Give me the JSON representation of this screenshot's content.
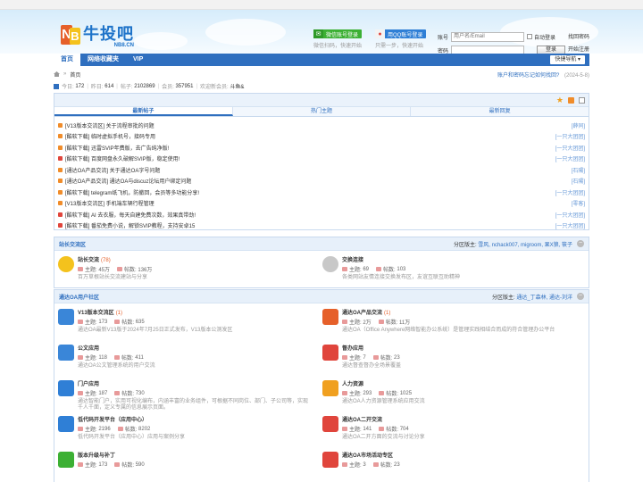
{
  "header": {
    "logo_title": "牛投吧",
    "logo_sub": "NB8.CN",
    "wechat_label": "微信账号登录",
    "wechat_sub": "微信扫码，快速开始",
    "qq_label": "用QQ账号登录",
    "qq_sub": "只需一步，快速开始",
    "account_label": "账号",
    "account_placeholder": "用户名/Email",
    "auto_login": "自动登录",
    "find_password": "找回密码",
    "password_label": "密码",
    "login_button": "登录",
    "register": "开始注册"
  },
  "nav": {
    "items": [
      {
        "label": "首页"
      },
      {
        "label": "网络收藏夹"
      },
      {
        "label": "VIP"
      }
    ],
    "quick": "快捷导航 ▾"
  },
  "breadcrumb": {
    "home": "首页",
    "right_link": "账户和密码忘记如何找回?",
    "right_date": "(2024-5-8)"
  },
  "stats": {
    "today_label": "今日:",
    "today": "172",
    "yesterday_label": "昨日:",
    "yesterday": "614",
    "posts_label": "帖子:",
    "posts": "2102869",
    "members_label": "会员:",
    "members": "357951",
    "welcome_label": "欢迎新会员:",
    "welcome": "斗鱼&"
  },
  "tabs": [
    "最新帖子",
    "热门主题",
    "最新回复"
  ],
  "threads": [
    {
      "title": "[V13版本交流区] 关于流程审批的问题",
      "author": "[薛同]",
      "color": "#f08c2a"
    },
    {
      "title": "[酷软下载] 临时虚拟手机号，接码专用",
      "author": "[一只大团团]",
      "color": "#f08c2a"
    },
    {
      "title": "[酷软下载] 迅雷SVIP年费版，去广告纯净版!",
      "author": "[一只大团团]",
      "color": "#f08c2a"
    },
    {
      "title": "[酷软下载] 百度网盘永久破解SVIP版，稳定使用!",
      "author": "[一只大团团]",
      "color": "#e0453c"
    },
    {
      "title": "[通达OA产品交流] 关于通达OA字号问题",
      "author": "[石陽]",
      "color": "#f08c2a"
    },
    {
      "title": "[通达OA产品交流] 通达OA与discuz论坛用户绑定问题",
      "author": "[石陽]",
      "color": "#f08c2a"
    },
    {
      "title": "[酷软下载] telegram纸飞机，防撤回，会员等多功能分享!",
      "author": "[一只大团团]",
      "color": "#f08c2a"
    },
    {
      "title": "[V13版本交流区] 手机端车辆行程管理",
      "author": "[零客]",
      "color": "#f08c2a"
    },
    {
      "title": "[酷软下载] AI 去衣服，每天自建免费次数，效果真带劲!",
      "author": "[一只大团团]",
      "color": "#e0453c"
    },
    {
      "title": "[酷软下载] 番茄免费小说，解锁SVIP教程，支持安卓15",
      "author": "[一只大团团]",
      "color": "#e0453c"
    }
  ],
  "section1": {
    "name": "站长交流区",
    "mods_label": "分区版主:",
    "mods": "雪风, nchack007, migroom, 果X狼, 筱子",
    "forums": [
      {
        "title": "站长交流",
        "new": "(78)",
        "topic_label": "主题:",
        "topics": "45万",
        "post_label": "帖数:",
        "posts": "136万",
        "desc": "百万草根站长交流建站与分享"
      },
      {
        "title": "交换连接",
        "new": "",
        "topic_label": "主题:",
        "topics": "69",
        "post_label": "帖数:",
        "posts": "103",
        "desc": "各类网站友情连接交换发布区，友谊互联互助精神"
      }
    ]
  },
  "section2": {
    "name": "通达OA用户社区",
    "mods_label": "分区版主:",
    "mods": "通达_丁森林, 通达-刘洋",
    "forums": [
      {
        "title": "V13版本交流区",
        "new": "(1)",
        "topic_label": "主题:",
        "topics": "173",
        "post_label": "帖数:",
        "posts": "635",
        "desc": "通达OA最新V13版于2024年7月25日正式发布，V13版本公测发区"
      },
      {
        "title": "通达OA产品交流",
        "new": "(1)",
        "topic_label": "主题:",
        "topics": "2万",
        "post_label": "帖数:",
        "posts": "11万",
        "desc": "通达OA（Office Anywhere网络智能办公系统）是管理实践相结合而成的符合管理办公平台"
      },
      {
        "title": "公文应用",
        "new": "",
        "topic_label": "主题:",
        "topics": "118",
        "post_label": "帖数:",
        "posts": "411",
        "desc": "通达OA公文管理系统的用户交流"
      },
      {
        "title": "督办应用",
        "new": "",
        "topic_label": "主题:",
        "topics": "7",
        "post_label": "帖数:",
        "posts": "23",
        "desc": "通达督查督办全场景覆盖"
      },
      {
        "title": "门户应用",
        "new": "",
        "topic_label": "主题:",
        "topics": "187",
        "post_label": "帖数:",
        "posts": "730",
        "desc": "通达智能门户，实用可视化编布，内涵丰富的业务组件，可根据不同岗位、部门、子公司等，实现千人千面，定义专属的信息展示页面。"
      },
      {
        "title": "人力资源",
        "new": "",
        "topic_label": "主题:",
        "topics": "293",
        "post_label": "帖数:",
        "posts": "1025",
        "desc": "通达OA人力资源管理系统应用交流"
      },
      {
        "title": "低代码开发平台（应用中心）",
        "new": "",
        "topic_label": "主题:",
        "topics": "2196",
        "post_label": "帖数:",
        "posts": "8202",
        "desc": "低代码开发平台（应用中心）应用与案例分享"
      },
      {
        "title": "通达OA二开交流",
        "new": "",
        "topic_label": "主题:",
        "topics": "141",
        "post_label": "帖数:",
        "posts": "704",
        "desc": "通达OA二开方面的交流与讨论分享"
      },
      {
        "title": "版本升级与补丁",
        "new": "",
        "topic_label": "主题:",
        "topics": "173",
        "post_label": "帖数:",
        "posts": "590",
        "desc": ""
      },
      {
        "title": "通达OA市场活动专区",
        "new": "",
        "topic_label": "主题:",
        "topics": "3",
        "post_label": "帖数:",
        "posts": "23",
        "desc": ""
      }
    ]
  }
}
